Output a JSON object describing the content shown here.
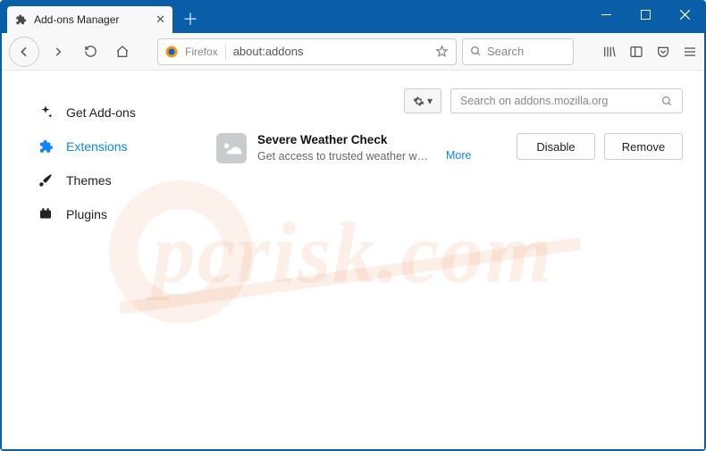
{
  "window": {
    "tab_title": "Add-ons Manager",
    "firefox_label": "Firefox",
    "address": "about:addons",
    "nav_search_placeholder": "Search"
  },
  "sidebar": {
    "items": [
      {
        "id": "get-addons",
        "label": "Get Add-ons"
      },
      {
        "id": "extensions",
        "label": "Extensions"
      },
      {
        "id": "themes",
        "label": "Themes"
      },
      {
        "id": "plugins",
        "label": "Plugins"
      }
    ],
    "active_index": 1
  },
  "toolbar": {
    "addon_search_placeholder": "Search on addons.mozilla.org"
  },
  "extension": {
    "name": "Severe Weather Check",
    "description": "Get access to trusted weather w…",
    "more_label": "More",
    "disable_label": "Disable",
    "remove_label": "Remove"
  },
  "watermark": "pcrisk.com"
}
